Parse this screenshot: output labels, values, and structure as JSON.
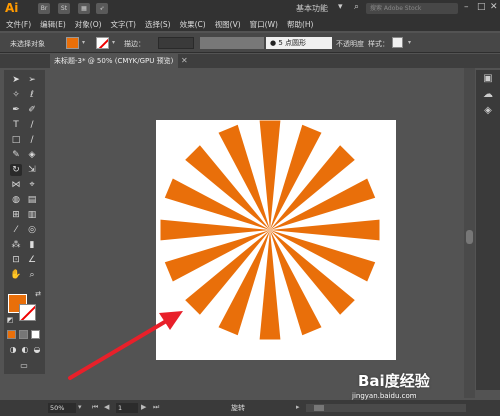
{
  "titlebar": {
    "logo": "Ai",
    "workspace": "基本功能",
    "search_placeholder": "搜索 Adobe Stock"
  },
  "menu": [
    "文件(F)",
    "编辑(E)",
    "对象(O)",
    "文字(T)",
    "选择(S)",
    "效果(C)",
    "视图(V)",
    "窗口(W)",
    "帮助(H)"
  ],
  "control_bar": {
    "selection": "未选择对象",
    "stroke_label": "描边：",
    "brush_value": "5 点圆形",
    "opacity_label": "不透明度",
    "style_label": "样式："
  },
  "document": {
    "tab_title": "未标题-3* @ 50% (CMYK/GPU 预览)"
  },
  "status": {
    "zoom": "50%",
    "page": "1",
    "tool_name": "旋转"
  },
  "artwork": {
    "ray_count": 16,
    "fill_color": "#e96f0a",
    "background": "#ffffff"
  },
  "colors": {
    "fill": "#e96f0a",
    "annotation_arrow": "#e8202a"
  },
  "watermark": {
    "brand": "Bai度经验",
    "url": "jingyan.baidu.com"
  }
}
